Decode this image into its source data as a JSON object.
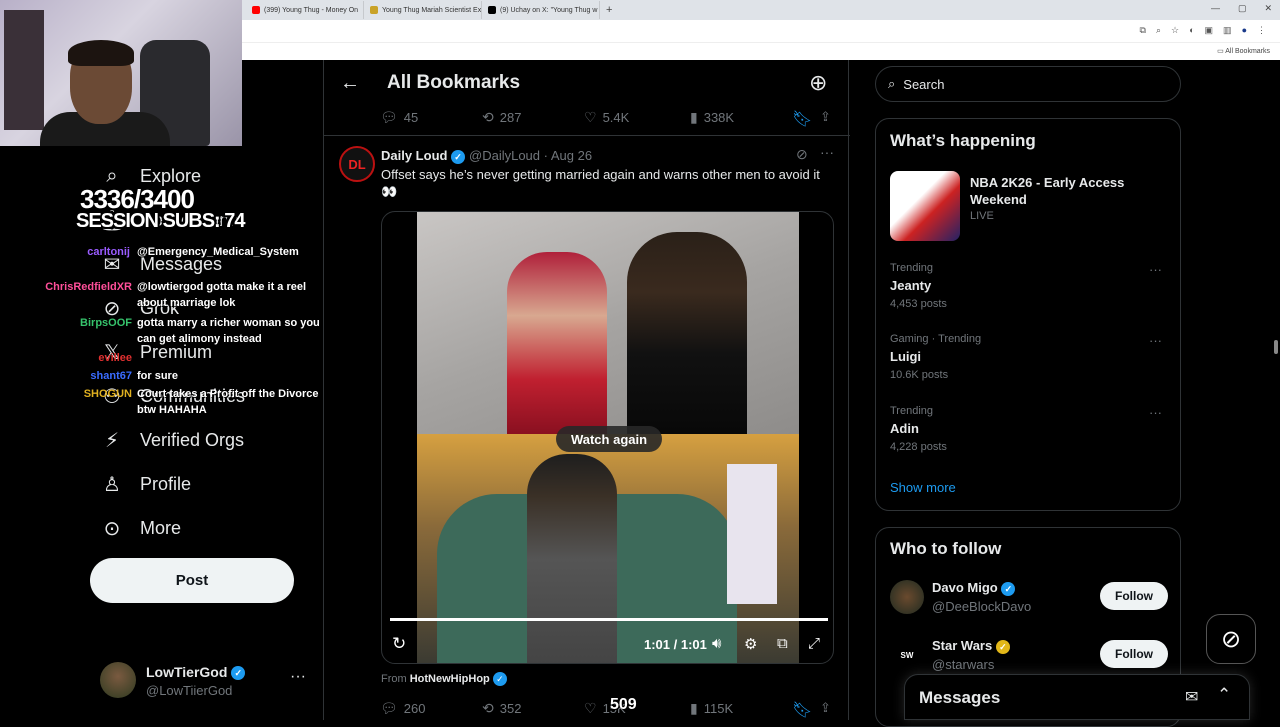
{
  "browser": {
    "tabs": [
      {
        "label": "(399) Young Thug - Money On",
        "color": "#ff0000"
      },
      {
        "label": "Young Thug Mariah Scientist Ex",
        "color": "#c9a227"
      },
      {
        "label": "(9) Uchay on X: \"Young Thug w",
        "color": "#000000"
      }
    ],
    "new_tab": "+",
    "bookmarks_label": "All Bookmarks"
  },
  "overlay": {
    "sub_count": "3336/3400",
    "session_subs": "SESSION SUBS: 74",
    "chat": [
      {
        "user": "carltonij",
        "user_color": "#9a5cff",
        "message": "@Emergency_Medical_System"
      },
      {
        "user": "ChrisRedfieldXR",
        "user_color": "#ff4f9a",
        "message": "@lowtiergod gotta make it a reel about marriage lok"
      },
      {
        "user": "BirpsOOF",
        "user_color": "#36c36c",
        "message": "gotta marry a richer woman so you can get alimony instead"
      },
      {
        "user": "evillee",
        "user_color": "#e03030",
        "message": ""
      },
      {
        "user": "shant67",
        "user_color": "#3a6cff",
        "message": "for sure"
      },
      {
        "user": "SHOGUN",
        "user_color": "#e0b020",
        "message": "Court takes a Profit off the Divorce btw HAHAHA"
      }
    ]
  },
  "nav": {
    "items": [
      {
        "label": "Explore",
        "icon": "search-icon"
      },
      {
        "label": "Notifications",
        "icon": "bell-icon"
      },
      {
        "label": "Messages",
        "icon": "mail-icon"
      },
      {
        "label": "Grok",
        "icon": "grok-icon"
      },
      {
        "label": "Premium",
        "icon": "x-logo-icon"
      },
      {
        "label": "Communities",
        "icon": "people-icon"
      },
      {
        "label": "Verified Orgs",
        "icon": "lightning-icon"
      },
      {
        "label": "Profile",
        "icon": "person-icon"
      },
      {
        "label": "More",
        "icon": "more-circle-icon"
      }
    ],
    "post_label": "Post",
    "account": {
      "name": "LowTierGod",
      "handle": "@LowTiierGod",
      "more": "···"
    }
  },
  "main": {
    "title": "All Bookmarks",
    "prev_actions": {
      "replies": "45",
      "reposts": "287",
      "likes": "5.4K",
      "views": "338K"
    },
    "tweet": {
      "avatar_text": "DL",
      "name": "Daily Loud",
      "handle_date": "@DailyLoud · Aug 26",
      "text": "Offset says he’s never getting married again and warns other men to avoid it 👀",
      "watch_again": "Watch again",
      "time": "1:01 / 1:01",
      "progress": 1.0,
      "from_prefix": "From",
      "from_source": "HotNewHipHop",
      "actions": {
        "replies": "260",
        "reposts": "352",
        "likes": "15K",
        "views": "115K"
      }
    },
    "stream_alert": "509"
  },
  "sidebar": {
    "search_placeholder": "Search",
    "trends_title": "What’s happening",
    "promo": {
      "title": "NBA 2K26 - Early Access Weekend",
      "status": "LIVE"
    },
    "trends": [
      {
        "meta": "Trending",
        "name": "Jeanty",
        "posts": "4,453 posts"
      },
      {
        "meta": "Gaming · Trending",
        "name": "Luigi",
        "posts": "10.6K posts"
      },
      {
        "meta": "Trending",
        "name": "Adin",
        "posts": "4,228 posts"
      }
    ],
    "show_more": "Show more",
    "who_title": "Who to follow",
    "follow": [
      {
        "name": "Davo Migo",
        "handle": "@DeeBlockDavo",
        "button": "Follow",
        "badge": "blue"
      },
      {
        "name": "Star Wars",
        "handle": "@starwars",
        "button": "Follow",
        "badge": "gold"
      }
    ],
    "messages_title": "Messages"
  }
}
